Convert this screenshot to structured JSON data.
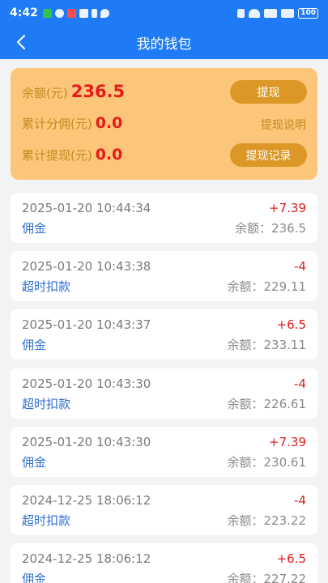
{
  "status_bar": {
    "time": "4:42",
    "battery": "100"
  },
  "nav": {
    "title": "我的钱包"
  },
  "wallet": {
    "balance_label": "余额(元)",
    "balance_value": "236.5",
    "commission_label": "累计分佣(元)",
    "commission_value": "0.0",
    "withdrawn_label": "累计提现(元)",
    "withdrawn_value": "0.0",
    "withdraw_button": "提现",
    "withdraw_info_link": "提现说明",
    "withdraw_records_button": "提现记录"
  },
  "transactions": [
    {
      "date": "2025-01-20 10:44:34",
      "type": "佣金",
      "amount": "+7.39",
      "balance": "余额：236.5"
    },
    {
      "date": "2025-01-20 10:43:38",
      "type": "超时扣款",
      "amount": "-4",
      "balance": "余额：229.11"
    },
    {
      "date": "2025-01-20 10:43:37",
      "type": "佣金",
      "amount": "+6.5",
      "balance": "余额：233.11"
    },
    {
      "date": "2025-01-20 10:43:30",
      "type": "超时扣款",
      "amount": "-4",
      "balance": "余额：226.61"
    },
    {
      "date": "2025-01-20 10:43:30",
      "type": "佣金",
      "amount": "+7.39",
      "balance": "余额：230.61"
    },
    {
      "date": "2024-12-25 18:06:12",
      "type": "超时扣款",
      "amount": "-4",
      "balance": "余额：223.22"
    },
    {
      "date": "2024-12-25 18:06:12",
      "type": "佣金",
      "amount": "+6.5",
      "balance": "余额：227.22"
    }
  ]
}
